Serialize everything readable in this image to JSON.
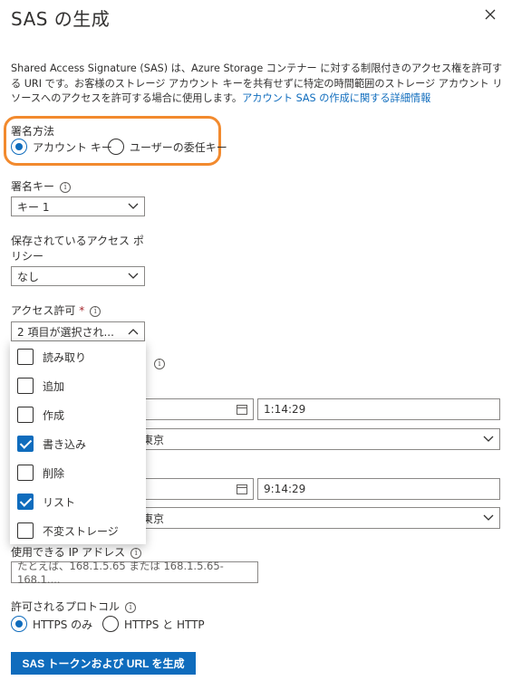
{
  "panel": {
    "title": "SAS の生成",
    "description": "Shared Access Signature (SAS) は、Azure Storage コンテナー に対する制限付きのアクセス権を許可する URI です。お客様のストレージ アカウント キーを共有せずに特定の時間範囲のストレージ アカウント リソースへのアクセスを許可する場合に使用します。",
    "description_link": "アカウント SAS の作成に関する詳細情報"
  },
  "signing_method": {
    "label": "署名方法",
    "options": [
      {
        "label": "アカウント キー",
        "selected": true
      },
      {
        "label": "ユーザーの委任キー",
        "selected": false
      }
    ]
  },
  "signing_key": {
    "label": "署名キー",
    "value": "キー 1"
  },
  "stored_policy": {
    "label": "保存されているアクセス ポリシー",
    "value": "なし"
  },
  "permissions": {
    "label": "アクセス許可",
    "required_mark": "*",
    "value": "2 項目が選択され...",
    "options": [
      {
        "label": "読み取り",
        "checked": false
      },
      {
        "label": "追加",
        "checked": false
      },
      {
        "label": "作成",
        "checked": false
      },
      {
        "label": "書き込み",
        "checked": true
      },
      {
        "label": "削除",
        "checked": false
      },
      {
        "label": "リスト",
        "checked": true
      },
      {
        "label": "不変ストレージ",
        "checked": false
      }
    ]
  },
  "start": {
    "time": "1:14:29",
    "timezone": "東京"
  },
  "expiry": {
    "time": "9:14:29",
    "timezone": "東京"
  },
  "ip": {
    "label": "使用できる IP アドレス",
    "placeholder": "たとえば、168.1.5.65 または 168.1.5.65-168.1...."
  },
  "protocols": {
    "label": "許可されるプロトコル",
    "options": [
      {
        "label": "HTTPS のみ",
        "selected": true
      },
      {
        "label": "HTTPS と HTTP",
        "selected": false
      }
    ]
  },
  "generate_button": "SAS トークンおよび URL を生成",
  "colors": {
    "accent": "#0f6cbd",
    "highlight": "#f28a2e"
  }
}
